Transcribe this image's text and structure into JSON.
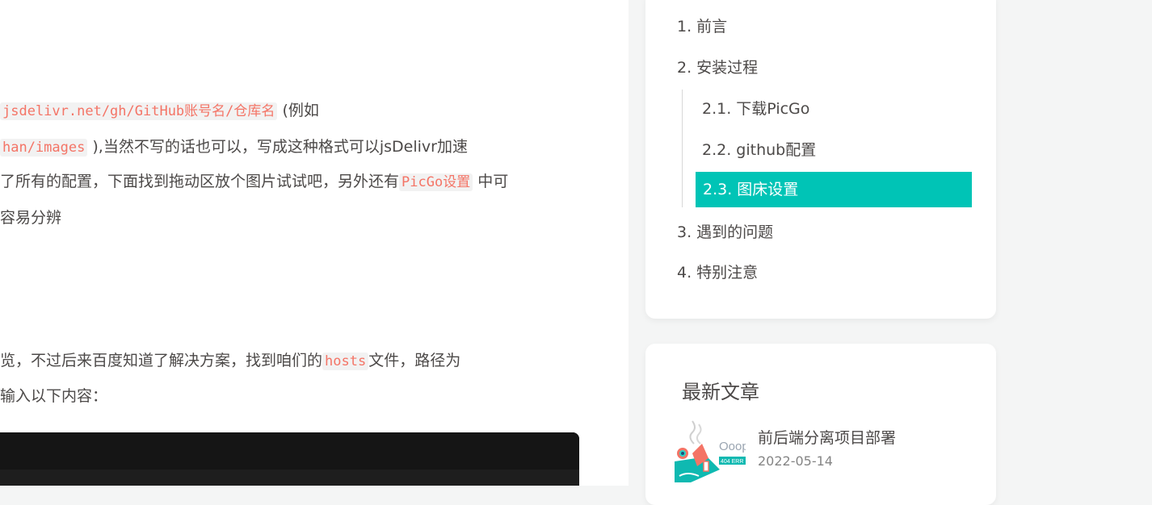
{
  "article": {
    "line1": {
      "code": "jsdelivr.net/gh/GitHub账号名/仓库名",
      "text_after": " (例如"
    },
    "line2": {
      "code": "han/images",
      "text_after": " ),当然不写的话也可以，写成这种格式可以jsDelivr加速"
    },
    "line3": {
      "text_before": "了所有的配置，下面找到拖动区放个图片试试吧，另外还有",
      "code": "PicGo设置",
      "text_after": " 中可"
    },
    "line4": {
      "text": "容易分辨"
    },
    "line5": {
      "text_before": "览，不过后来百度知道了解决方案，找到咱们的",
      "code": "hosts",
      "text_after": "文件，路径为"
    },
    "line6": {
      "text": "输入以下内容："
    }
  },
  "toc": {
    "items": [
      {
        "label": "1. 前言"
      },
      {
        "label": "2. 安装过程"
      },
      {
        "label": "2.1. 下载PicGo"
      },
      {
        "label": "2.2. github配置"
      },
      {
        "label": "2.3. 图床设置"
      },
      {
        "label": "3. 遇到的问题"
      },
      {
        "label": "4. 特别注意"
      }
    ],
    "active_color": "#00c4b6"
  },
  "recent": {
    "title": "最新文章",
    "posts": [
      {
        "title": "前后端分离项目部署",
        "date": "2022-05-14",
        "thumb_text": "Ooop",
        "thumb_badge": "404 ERR"
      }
    ]
  }
}
